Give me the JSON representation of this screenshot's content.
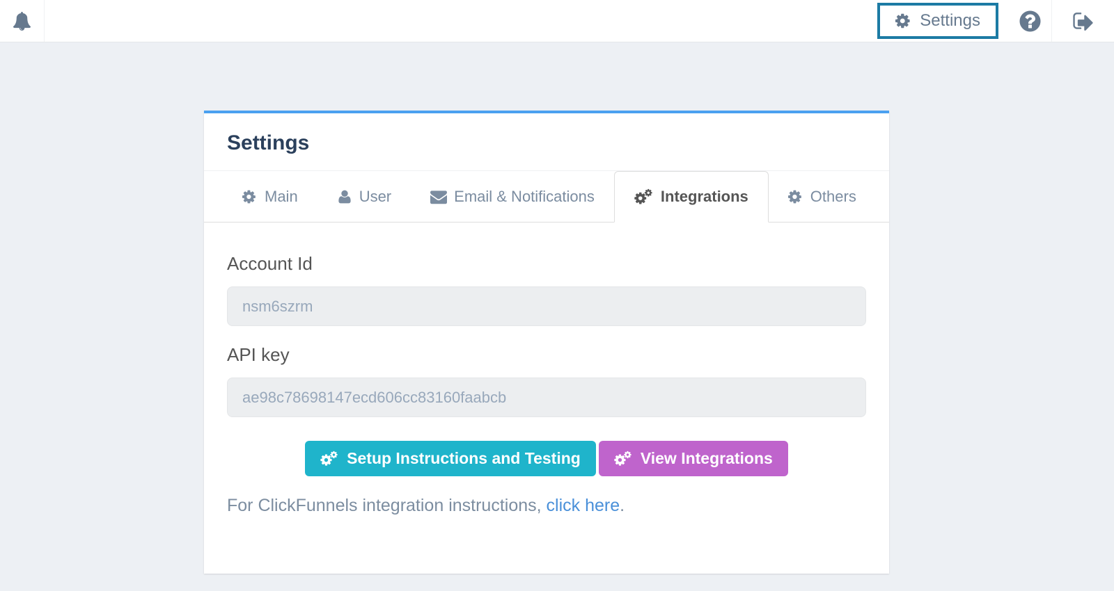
{
  "navbar": {
    "bell_icon": "bell-icon",
    "settings_button": {
      "label": "Settings",
      "icon": "gear-icon"
    },
    "help_icon": "question-circle-icon",
    "logout_icon": "sign-out-icon"
  },
  "card": {
    "title": "Settings",
    "tabs": [
      {
        "label": "Main",
        "icon": "gear-icon",
        "active": false
      },
      {
        "label": "User",
        "icon": "user-icon",
        "active": false
      },
      {
        "label": "Email & Notifications",
        "icon": "envelope-icon",
        "active": false
      },
      {
        "label": "Integrations",
        "icon": "gears-icon",
        "active": true
      },
      {
        "label": "Others",
        "icon": "gear-icon",
        "active": false
      }
    ],
    "form": {
      "account_id": {
        "label": "Account Id",
        "value": "nsm6szrm"
      },
      "api_key": {
        "label": "API key",
        "value": "ae98c78698147ecd606cc83160faabcb"
      }
    },
    "buttons": {
      "setup": {
        "label": "Setup Instructions and Testing",
        "icon": "gears-icon",
        "color": "#1fb4cb"
      },
      "view": {
        "label": "View Integrations",
        "icon": "gears-icon",
        "color": "#bf64cc"
      }
    },
    "footer": {
      "text_before": "For ClickFunnels integration instructions, ",
      "link_text": "click here",
      "text_after": "."
    }
  },
  "colors": {
    "page_background": "#edf0f4",
    "card_top_border": "#4aa0f0",
    "settings_button_border": "#1c7ba4",
    "icon_slate": "#66798e",
    "link": "#4a90d9",
    "teal_button": "#1fb4cb",
    "purple_button": "#bf64cc"
  }
}
